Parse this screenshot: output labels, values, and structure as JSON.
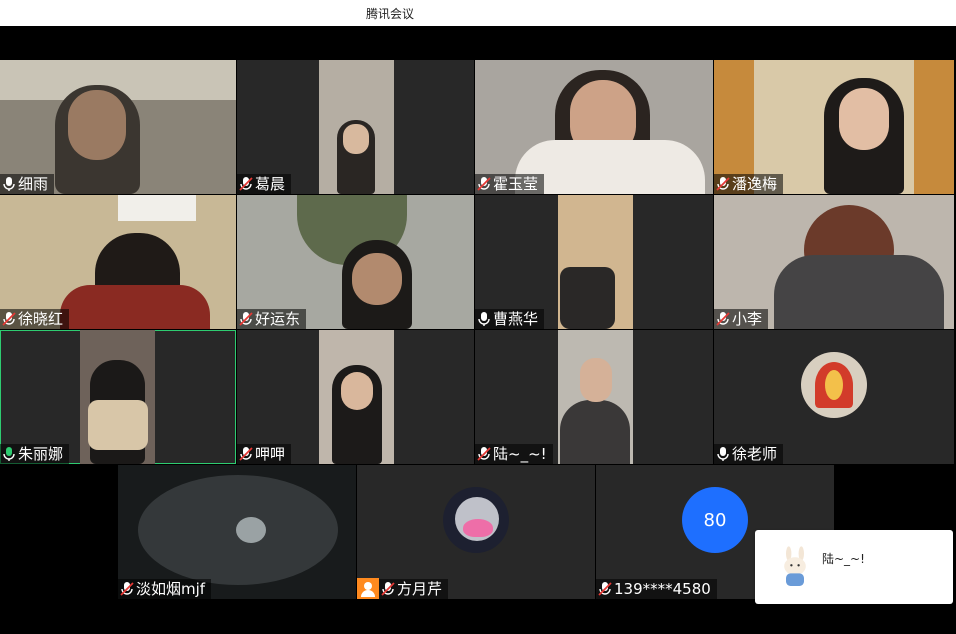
{
  "window": {
    "title": "腾讯会议"
  },
  "participants_row1": [
    {
      "name": "细雨",
      "mic": "on"
    },
    {
      "name": "葛晨",
      "mic": "muted"
    },
    {
      "name": "霍玉莹",
      "mic": "muted"
    },
    {
      "name": "潘逸梅",
      "mic": "muted"
    }
  ],
  "participants_row2": [
    {
      "name": "徐晓红",
      "mic": "muted"
    },
    {
      "name": "好运东",
      "mic": "muted"
    },
    {
      "name": "曹燕华",
      "mic": "on"
    },
    {
      "name": "小李",
      "mic": "muted"
    }
  ],
  "participants_row3": [
    {
      "name": "朱丽娜",
      "mic": "speaking"
    },
    {
      "name": "呷呷",
      "mic": "muted"
    },
    {
      "name": "陆~_~!",
      "mic": "muted"
    },
    {
      "name": "徐老师",
      "mic": "on"
    }
  ],
  "participants_row4": [
    {
      "name": "淡如烟mjf",
      "mic": "muted"
    },
    {
      "name": "方月芹",
      "mic": "muted"
    },
    {
      "name": "139****4580",
      "mic": "muted",
      "avatar_text": "80"
    }
  ],
  "chat_popup": {
    "name": "陆~_~!"
  },
  "colors": {
    "active_speaker": "#2ecc71",
    "avatar_blue": "#1e6fff",
    "host_badge": "#ff8a1f"
  }
}
